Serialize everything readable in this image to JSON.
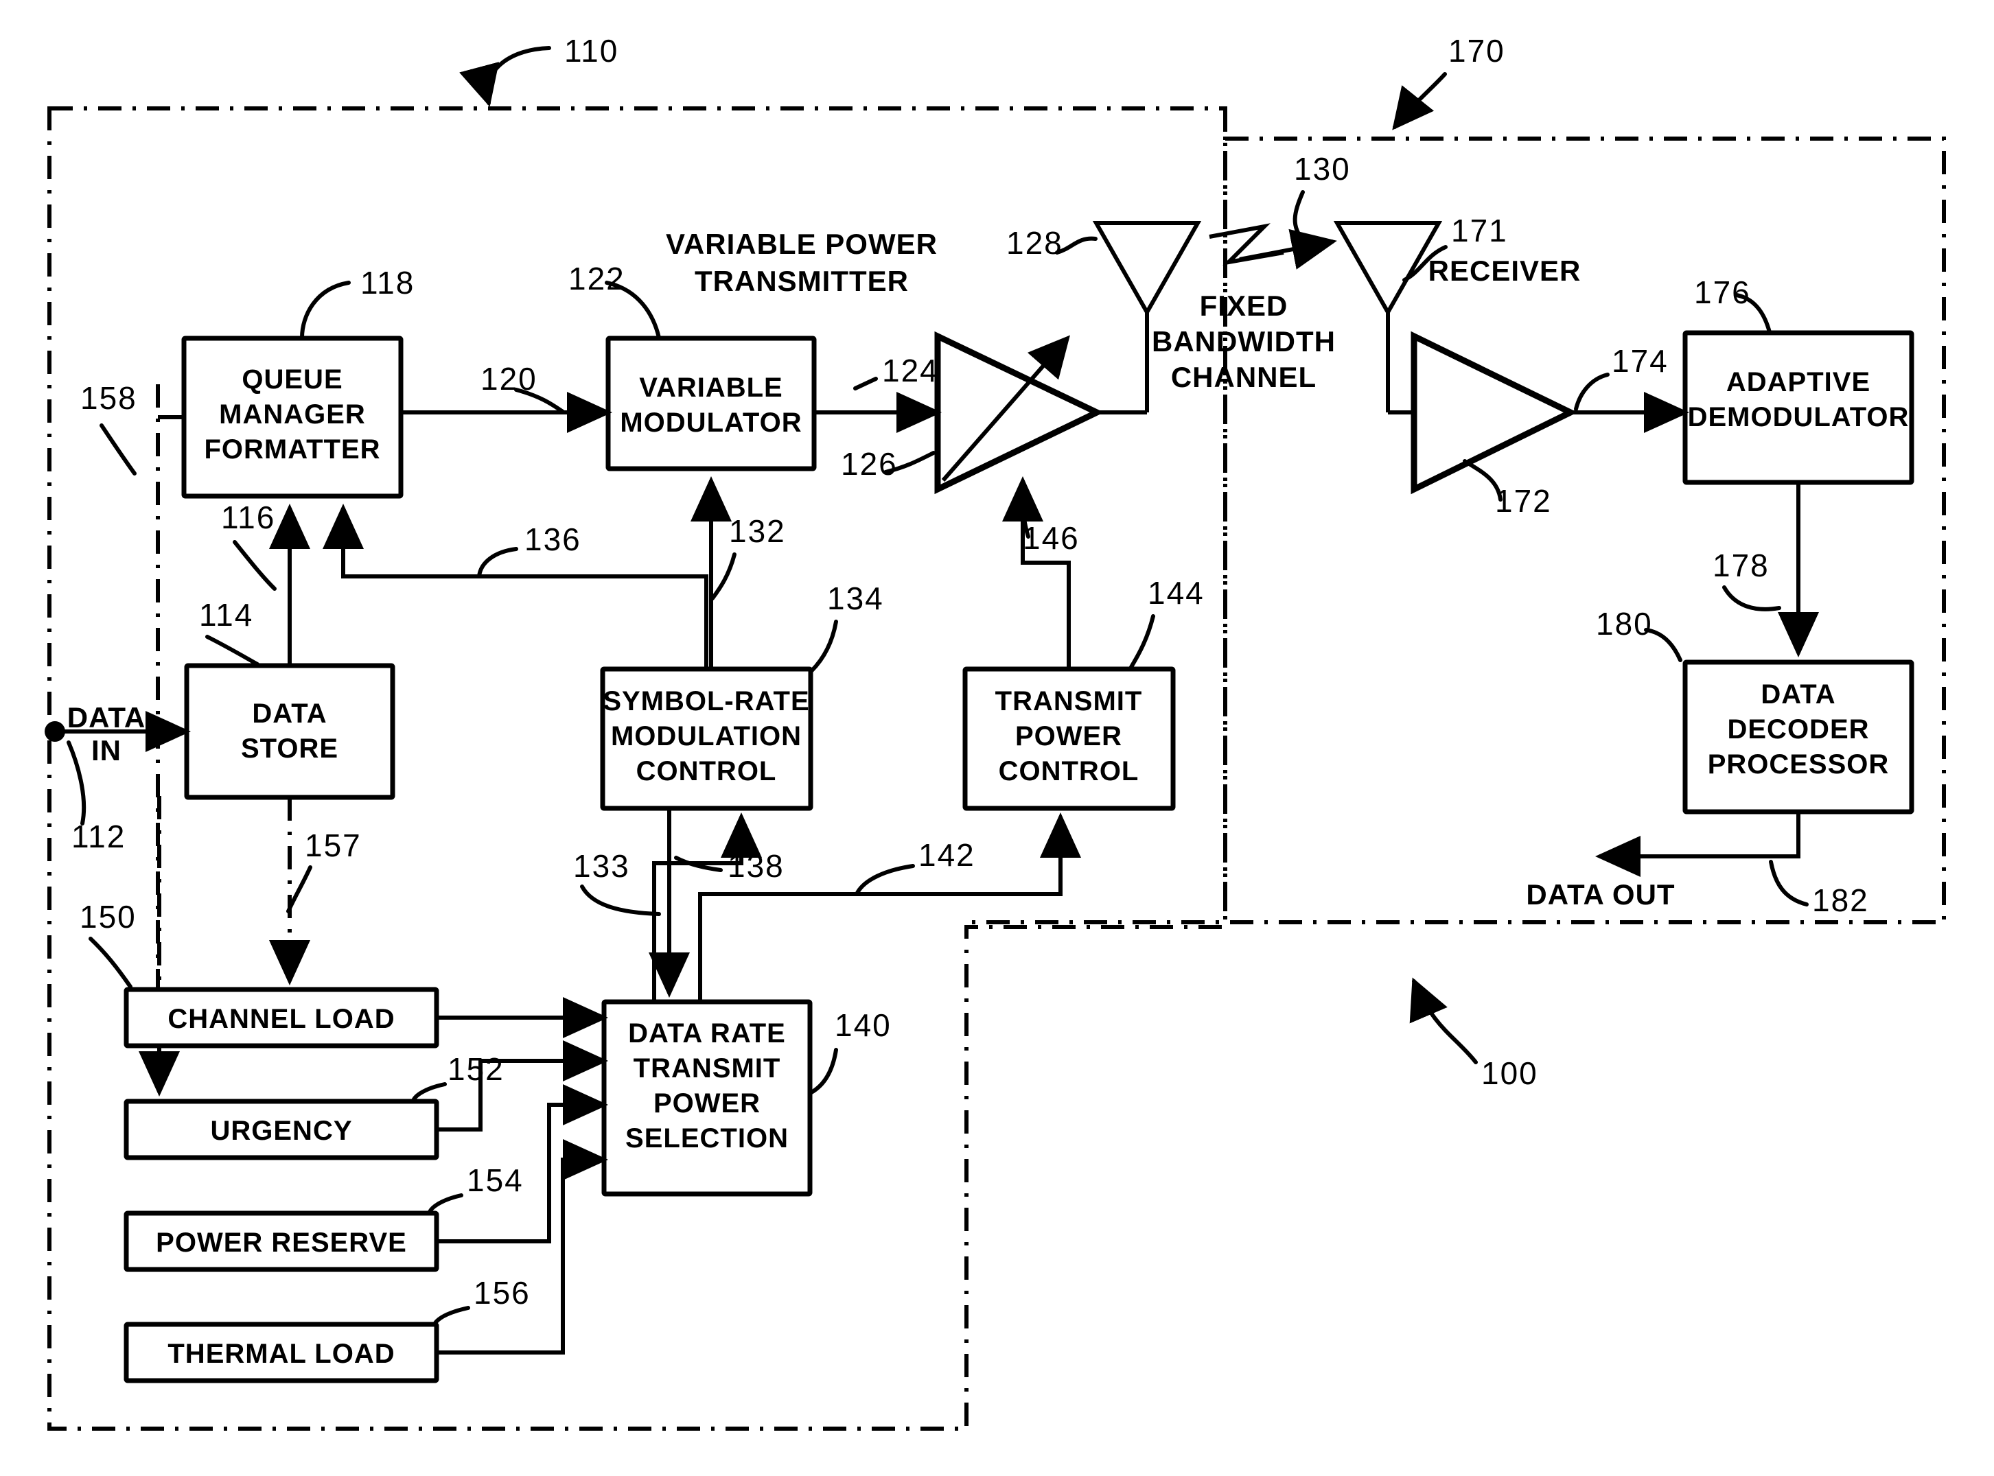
{
  "figure": {
    "title": "Adaptive data rate and transmit power communication system block diagram",
    "ink_color": "#000000",
    "background": "#ffffff"
  },
  "regions": [
    {
      "id": "transmitter-region",
      "ref": "110",
      "style": "dash-dot"
    },
    {
      "id": "receiver-region",
      "ref": "170",
      "style": "dash-dot"
    },
    {
      "id": "system-region",
      "ref": "100",
      "style": "dash-dot"
    },
    {
      "id": "channel-divider",
      "ref": "130",
      "style": "dash-dot-vertical"
    }
  ],
  "blocks": [
    {
      "id": "queue-manager-formatter",
      "ref": "118",
      "lines": [
        "QUEUE",
        "MANAGER",
        "FORMATTER"
      ]
    },
    {
      "id": "variable-modulator",
      "ref": "122",
      "lines": [
        "VARIABLE",
        "MODULATOR"
      ]
    },
    {
      "id": "data-store",
      "ref": "114",
      "lines": [
        "DATA",
        "STORE"
      ]
    },
    {
      "id": "symbol-rate-modulation-control",
      "ref": "134",
      "lines": [
        "SYMBOL-RATE",
        "MODULATION",
        "CONTROL"
      ]
    },
    {
      "id": "transmit-power-control",
      "ref": "144",
      "lines": [
        "TRANSMIT",
        "POWER",
        "CONTROL"
      ]
    },
    {
      "id": "data-rate-transmit-power-selection",
      "ref": "140",
      "lines": [
        "DATA RATE",
        "TRANSMIT",
        "POWER",
        "SELECTION"
      ]
    },
    {
      "id": "channel-load",
      "ref": "150",
      "lines": [
        "CHANNEL LOAD"
      ]
    },
    {
      "id": "urgency",
      "ref": "152",
      "lines": [
        "URGENCY"
      ]
    },
    {
      "id": "power-reserve",
      "ref": "154",
      "lines": [
        "POWER RESERVE"
      ]
    },
    {
      "id": "thermal-load",
      "ref": "156",
      "lines": [
        "THERMAL LOAD"
      ]
    },
    {
      "id": "adaptive-demodulator",
      "ref": "176",
      "lines": [
        "ADAPTIVE",
        "DEMODULATOR"
      ]
    },
    {
      "id": "data-decoder-processor",
      "ref": "180",
      "lines": [
        "DATA",
        "DECODER",
        "PROCESSOR"
      ]
    }
  ],
  "symbols": [
    {
      "id": "variable-power-amplifier",
      "ref": "126",
      "shape": "triangle-amplifier-variable"
    },
    {
      "id": "transmit-antenna",
      "ref": "128",
      "shape": "antenna"
    },
    {
      "id": "receive-antenna",
      "ref": "171",
      "shape": "antenna"
    },
    {
      "id": "receiver-amplifier",
      "ref": "172",
      "shape": "triangle-amplifier"
    }
  ],
  "free_text": [
    {
      "id": "variable-power-transmitter-caption",
      "lines": [
        "VARIABLE POWER",
        "TRANSMITTER"
      ]
    },
    {
      "id": "fixed-bandwidth-channel-caption",
      "lines": [
        "FIXED",
        "BANDWIDTH",
        "CHANNEL"
      ]
    },
    {
      "id": "receiver-caption",
      "lines": [
        "RECEIVER"
      ]
    },
    {
      "id": "data-in-caption",
      "lines": [
        "DATA",
        "IN"
      ]
    },
    {
      "id": "data-out-caption",
      "lines": [
        "DATA OUT"
      ]
    }
  ],
  "labels": {
    "queue_manager_l1": "QUEUE",
    "queue_manager_l2": "MANAGER",
    "queue_manager_l3": "FORMATTER",
    "variable_modulator_l1": "VARIABLE",
    "variable_modulator_l2": "MODULATOR",
    "data_store_l1": "DATA",
    "data_store_l2": "STORE",
    "symbol_rate_l1": "SYMBOL-RATE",
    "symbol_rate_l2": "MODULATION",
    "symbol_rate_l3": "CONTROL",
    "transmit_power_l1": "TRANSMIT",
    "transmit_power_l2": "POWER",
    "transmit_power_l3": "CONTROL",
    "drtps_l1": "DATA RATE",
    "drtps_l2": "TRANSMIT",
    "drtps_l3": "POWER",
    "drtps_l4": "SELECTION",
    "channel_load": "CHANNEL LOAD",
    "urgency": "URGENCY",
    "power_reserve": "POWER RESERVE",
    "thermal_load": "THERMAL LOAD",
    "adaptive_demod_l1": "ADAPTIVE",
    "adaptive_demod_l2": "DEMODULATOR",
    "data_decoder_l1": "DATA",
    "data_decoder_l2": "DECODER",
    "data_decoder_l3": "PROCESSOR",
    "vpt_l1": "VARIABLE POWER",
    "vpt_l2": "TRANSMITTER",
    "fbc_l1": "FIXED",
    "fbc_l2": "BANDWIDTH",
    "fbc_l3": "CHANNEL",
    "receiver": "RECEIVER",
    "data_in_l1": "DATA",
    "data_in_l2": "IN",
    "data_out": "DATA OUT"
  },
  "refs": {
    "r100": "100",
    "r110": "110",
    "r112": "112",
    "r114": "114",
    "r116": "116",
    "r118": "118",
    "r120": "120",
    "r122": "122",
    "r124": "124",
    "r126": "126",
    "r128": "128",
    "r130": "130",
    "r132": "132",
    "r133": "133",
    "r134": "134",
    "r136": "136",
    "r138": "138",
    "r140": "140",
    "r142": "142",
    "r144": "144",
    "r146": "146",
    "r150": "150",
    "r152": "152",
    "r154": "154",
    "r156": "156",
    "r157": "157",
    "r158": "158",
    "r170": "170",
    "r171": "171",
    "r172": "172",
    "r174": "174",
    "r176": "176",
    "r178": "178",
    "r180": "180",
    "r182": "182"
  }
}
